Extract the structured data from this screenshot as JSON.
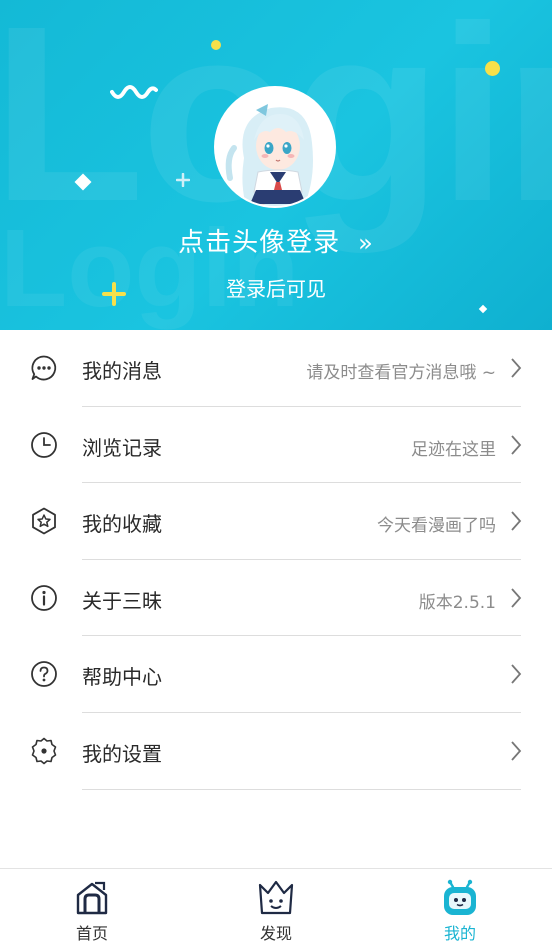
{
  "header": {
    "bg_watermark": "Login",
    "login_prompt": "点击头像登录",
    "login_arrow": "»",
    "subtitle": "登录后可见"
  },
  "menu": {
    "items": [
      {
        "label": "我的消息",
        "desc": "请及时查看官方消息哦 ~",
        "icon": "message-icon"
      },
      {
        "label": "浏览记录",
        "desc": "足迹在这里",
        "icon": "clock-icon"
      },
      {
        "label": "我的收藏",
        "desc": "今天看漫画了吗",
        "icon": "star-hexagon-icon"
      },
      {
        "label": "关于三昧",
        "desc": "版本2.5.1",
        "icon": "info-icon"
      },
      {
        "label": "帮助中心",
        "desc": "",
        "icon": "help-icon"
      },
      {
        "label": "我的设置",
        "desc": "",
        "icon": "settings-icon"
      }
    ]
  },
  "tabbar": {
    "tabs": [
      {
        "label": "首页",
        "icon": "home-icon"
      },
      {
        "label": "发现",
        "icon": "crown-icon"
      },
      {
        "label": "我的",
        "icon": "robot-icon",
        "active": true
      }
    ]
  },
  "colors": {
    "accent": "#1ab4d2",
    "header": "#1ac4e0"
  }
}
